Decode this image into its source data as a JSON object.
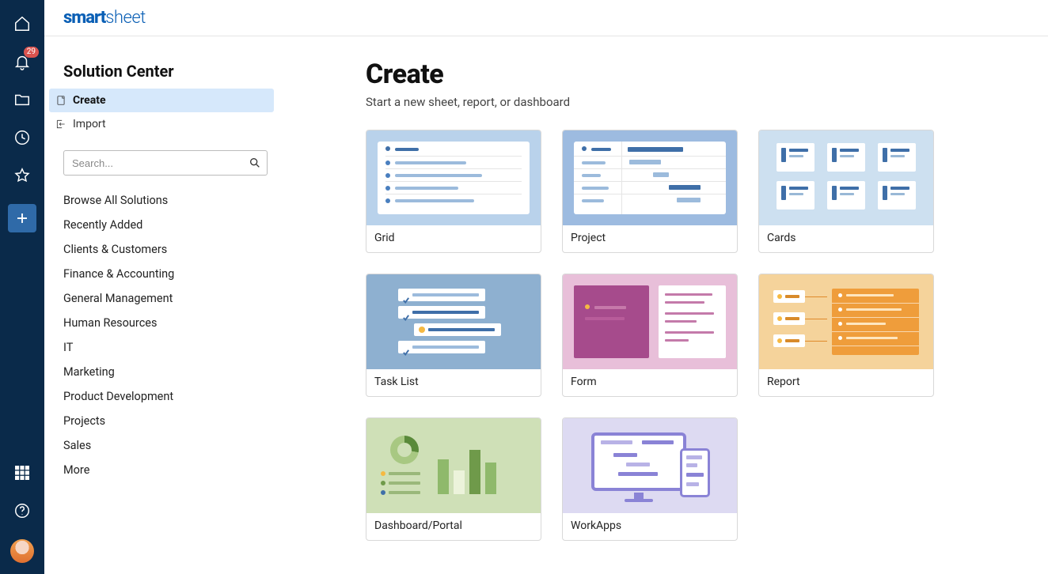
{
  "brand": {
    "name_bold": "smart",
    "name_thin": "sheet"
  },
  "rail": {
    "notification_count": "29"
  },
  "sidebar": {
    "title": "Solution Center",
    "nav": {
      "create": "Create",
      "import": "Import"
    },
    "search_placeholder": "Search...",
    "categories": [
      "Browse All Solutions",
      "Recently Added",
      "Clients & Customers",
      "Finance & Accounting",
      "General Management",
      "Human Resources",
      "IT",
      "Marketing",
      "Product Development",
      "Projects",
      "Sales",
      "More"
    ]
  },
  "content": {
    "title": "Create",
    "subtitle": "Start a new sheet, report, or dashboard",
    "tiles": [
      {
        "label": "Grid"
      },
      {
        "label": "Project"
      },
      {
        "label": "Cards"
      },
      {
        "label": "Task List"
      },
      {
        "label": "Form"
      },
      {
        "label": "Report"
      },
      {
        "label": "Dashboard/Portal"
      },
      {
        "label": "WorkApps"
      }
    ]
  }
}
